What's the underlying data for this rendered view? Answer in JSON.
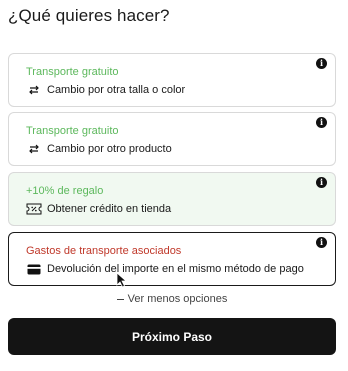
{
  "header": {
    "title": "¿Qué quieres hacer?"
  },
  "options": [
    {
      "badge": "Transporte gratuito",
      "badge_color": "#5cb85c",
      "icon": "exchange-arrows-icon",
      "label": "Cambio por otra talla o color",
      "info": "i"
    },
    {
      "badge": "Transporte gratuito",
      "badge_color": "#5cb85c",
      "icon": "exchange-arrows-icon",
      "label": "Cambio por otro producto",
      "info": "i"
    },
    {
      "badge": "+10% de regalo",
      "badge_color": "#5cb85c",
      "icon": "voucher-percent-icon",
      "label": "Obtener crédito en tienda",
      "info": "i"
    },
    {
      "badge": "Gastos de transporte asociados",
      "badge_color": "#c0392b",
      "icon": "credit-card-icon",
      "label": "Devolución del importe en el mismo método de pago",
      "info": "i",
      "selected": true
    }
  ],
  "show_less": {
    "label": "Ver menos opciones"
  },
  "next_button": {
    "label": "Próximo Paso"
  }
}
